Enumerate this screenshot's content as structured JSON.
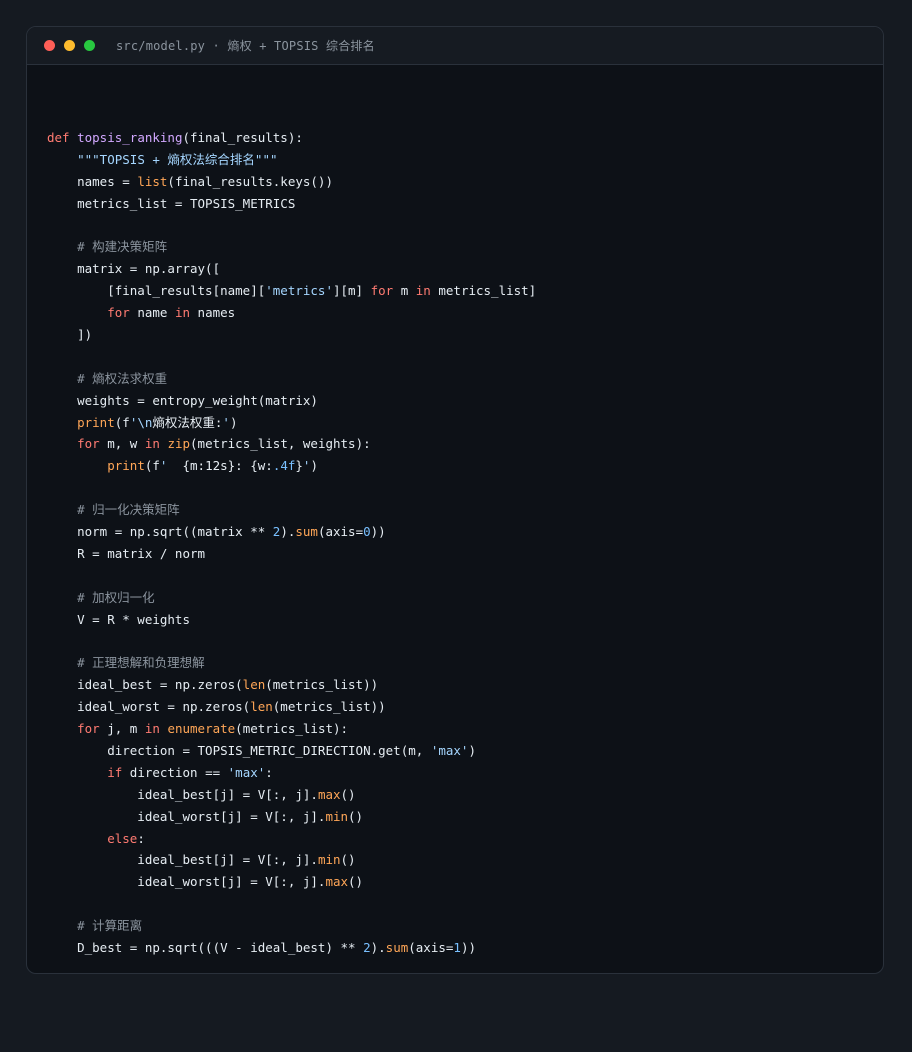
{
  "window": {
    "title": "src/model.py · 熵权 + TOPSIS 综合排名"
  },
  "code": {
    "language": "python",
    "lines": [
      [
        [
          "kw",
          "def"
        ],
        [
          "pl",
          " "
        ],
        [
          "fn",
          "topsis_ranking"
        ],
        [
          "pl",
          "(final_results):"
        ]
      ],
      [
        [
          "pl",
          "    "
        ],
        [
          "str",
          "\"\"\"TOPSIS + 熵权法综合排名\"\"\""
        ]
      ],
      [
        [
          "pl",
          "    names = "
        ],
        [
          "bi",
          "list"
        ],
        [
          "pl",
          "(final_results.keys())"
        ]
      ],
      [
        [
          "pl",
          "    metrics_list = TOPSIS_METRICS"
        ]
      ],
      [],
      [
        [
          "pl",
          "    "
        ],
        [
          "cm",
          "# 构建决策矩阵"
        ]
      ],
      [
        [
          "pl",
          "    matrix = np.array(["
        ]
      ],
      [
        [
          "pl",
          "        [final_results[name]["
        ],
        [
          "str",
          "'metrics'"
        ],
        [
          "pl",
          "][m] "
        ],
        [
          "kw",
          "for"
        ],
        [
          "pl",
          " m "
        ],
        [
          "kw",
          "in"
        ],
        [
          "pl",
          " metrics_list]"
        ]
      ],
      [
        [
          "pl",
          "        "
        ],
        [
          "kw",
          "for"
        ],
        [
          "pl",
          " name "
        ],
        [
          "kw",
          "in"
        ],
        [
          "pl",
          " names"
        ]
      ],
      [
        [
          "pl",
          "    ])"
        ]
      ],
      [],
      [
        [
          "pl",
          "    "
        ],
        [
          "cm",
          "# 熵权法求权重"
        ]
      ],
      [
        [
          "pl",
          "    weights = entropy_weight(matrix)"
        ]
      ],
      [
        [
          "pl",
          "    "
        ],
        [
          "bi",
          "print"
        ],
        [
          "pl",
          "(f"
        ],
        [
          "str",
          "'\\n"
        ],
        [
          "pl",
          "熵权法权重:"
        ],
        [
          "str",
          "'"
        ],
        [
          "pl",
          ")"
        ]
      ],
      [
        [
          "pl",
          "    "
        ],
        [
          "kw",
          "for"
        ],
        [
          "pl",
          " m, w "
        ],
        [
          "kw",
          "in"
        ],
        [
          "pl",
          " "
        ],
        [
          "bi",
          "zip"
        ],
        [
          "pl",
          "(metrics_list, weights):"
        ]
      ],
      [
        [
          "pl",
          "        "
        ],
        [
          "bi",
          "print"
        ],
        [
          "pl",
          "(f"
        ],
        [
          "str",
          "'  "
        ],
        [
          "pl",
          "{m:12s}: {w:"
        ],
        [
          "num",
          ".4f"
        ],
        [
          "pl",
          "}"
        ],
        [
          "str",
          "'"
        ],
        [
          "pl",
          ")"
        ]
      ],
      [],
      [
        [
          "pl",
          "    "
        ],
        [
          "cm",
          "# 归一化决策矩阵"
        ]
      ],
      [
        [
          "pl",
          "    norm = np.sqrt((matrix ** "
        ],
        [
          "num",
          "2"
        ],
        [
          "pl",
          ")."
        ],
        [
          "bi",
          "sum"
        ],
        [
          "pl",
          "(axis="
        ],
        [
          "num",
          "0"
        ],
        [
          "pl",
          "))"
        ]
      ],
      [
        [
          "pl",
          "    R = matrix / norm"
        ]
      ],
      [],
      [
        [
          "pl",
          "    "
        ],
        [
          "cm",
          "# 加权归一化"
        ]
      ],
      [
        [
          "pl",
          "    V = R * weights"
        ]
      ],
      [],
      [
        [
          "pl",
          "    "
        ],
        [
          "cm",
          "# 正理想解和负理想解"
        ]
      ],
      [
        [
          "pl",
          "    ideal_best = np.zeros("
        ],
        [
          "bi",
          "len"
        ],
        [
          "pl",
          "(metrics_list))"
        ]
      ],
      [
        [
          "pl",
          "    ideal_worst = np.zeros("
        ],
        [
          "bi",
          "len"
        ],
        [
          "pl",
          "(metrics_list))"
        ]
      ],
      [
        [
          "pl",
          "    "
        ],
        [
          "kw",
          "for"
        ],
        [
          "pl",
          " j, m "
        ],
        [
          "kw",
          "in"
        ],
        [
          "pl",
          " "
        ],
        [
          "bi",
          "enumerate"
        ],
        [
          "pl",
          "(metrics_list):"
        ]
      ],
      [
        [
          "pl",
          "        direction = TOPSIS_METRIC_DIRECTION.get(m, "
        ],
        [
          "str",
          "'max'"
        ],
        [
          "pl",
          ")"
        ]
      ],
      [
        [
          "pl",
          "        "
        ],
        [
          "kw",
          "if"
        ],
        [
          "pl",
          " direction == "
        ],
        [
          "str",
          "'max'"
        ],
        [
          "pl",
          ":"
        ]
      ],
      [
        [
          "pl",
          "            ideal_best[j] = V[:, j]."
        ],
        [
          "bi",
          "max"
        ],
        [
          "pl",
          "()"
        ]
      ],
      [
        [
          "pl",
          "            ideal_worst[j] = V[:, j]."
        ],
        [
          "bi",
          "min"
        ],
        [
          "pl",
          "()"
        ]
      ],
      [
        [
          "pl",
          "        "
        ],
        [
          "kw",
          "else"
        ],
        [
          "pl",
          ":"
        ]
      ],
      [
        [
          "pl",
          "            ideal_best[j] = V[:, j]."
        ],
        [
          "bi",
          "min"
        ],
        [
          "pl",
          "()"
        ]
      ],
      [
        [
          "pl",
          "            ideal_worst[j] = V[:, j]."
        ],
        [
          "bi",
          "max"
        ],
        [
          "pl",
          "()"
        ]
      ],
      [],
      [
        [
          "pl",
          "    "
        ],
        [
          "cm",
          "# 计算距离"
        ]
      ],
      [
        [
          "pl",
          "    D_best = np.sqrt(((V - ideal_best) ** "
        ],
        [
          "num",
          "2"
        ],
        [
          "pl",
          ")."
        ],
        [
          "bi",
          "sum"
        ],
        [
          "pl",
          "(axis="
        ],
        [
          "num",
          "1"
        ],
        [
          "pl",
          "))"
        ]
      ]
    ]
  }
}
